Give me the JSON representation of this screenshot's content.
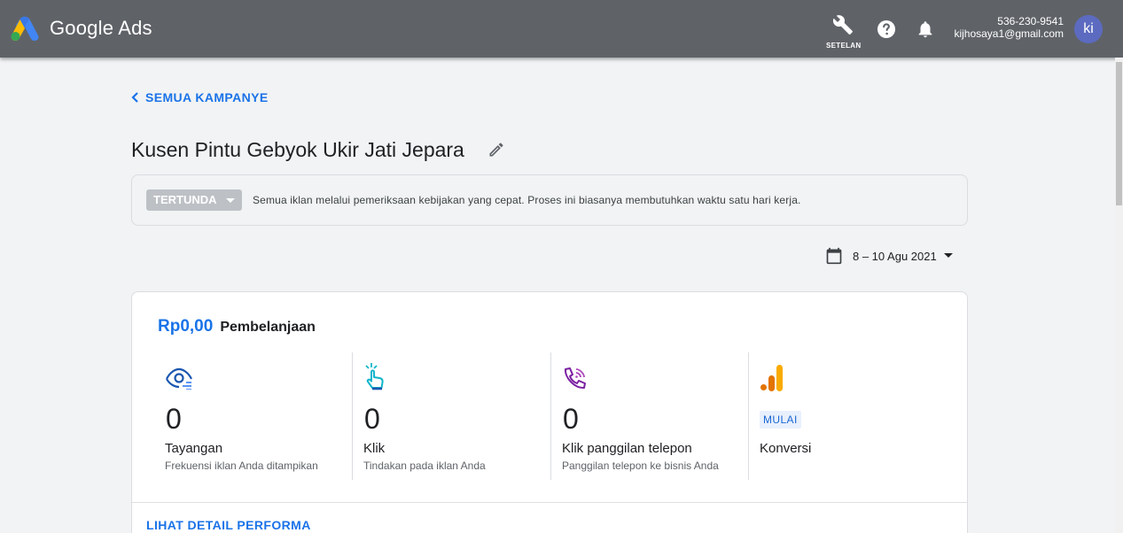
{
  "header": {
    "product_name": "Google Ads",
    "settings_label": "SETELAN",
    "account_id": "536-230-9541",
    "account_email": "kijhosaya1@gmail.com",
    "avatar_initials": "ki"
  },
  "nav": {
    "back_label": "SEMUA KAMPANYE"
  },
  "campaign": {
    "title": "Kusen Pintu Gebyok Ukir Jati Jepara"
  },
  "status": {
    "label": "TERTUNDA",
    "message": "Semua iklan melalui pemeriksaan kebijakan yang cepat. Proses ini biasanya membutuhkan waktu satu hari kerja."
  },
  "date_range": {
    "label": "8 – 10 Agu 2021"
  },
  "summary": {
    "spend_value": "Rp0,00",
    "spend_label": "Pembelanjaan",
    "metrics": [
      {
        "icon": "eye-icon",
        "value": "0",
        "name": "Tayangan",
        "description": "Frekuensi iklan Anda ditampikan"
      },
      {
        "icon": "tap-icon",
        "value": "0",
        "name": "Klik",
        "description": "Tindakan pada iklan Anda"
      },
      {
        "icon": "phone-call-icon",
        "value": "0",
        "name": "Klik panggilan telepon",
        "description": "Panggilan telepon ke bisnis Anda"
      },
      {
        "icon": "analytics-icon",
        "badge": "MULAI",
        "name": "Konversi"
      }
    ],
    "details_link": "LIHAT DETAIL PERFORMA"
  },
  "colors": {
    "header_bg": "#5f6368",
    "accent": "#1a73e8",
    "page_bg": "#f1f3f4",
    "status_chip": "#bdc1c6",
    "badge_bg": "#e8f0fe"
  }
}
